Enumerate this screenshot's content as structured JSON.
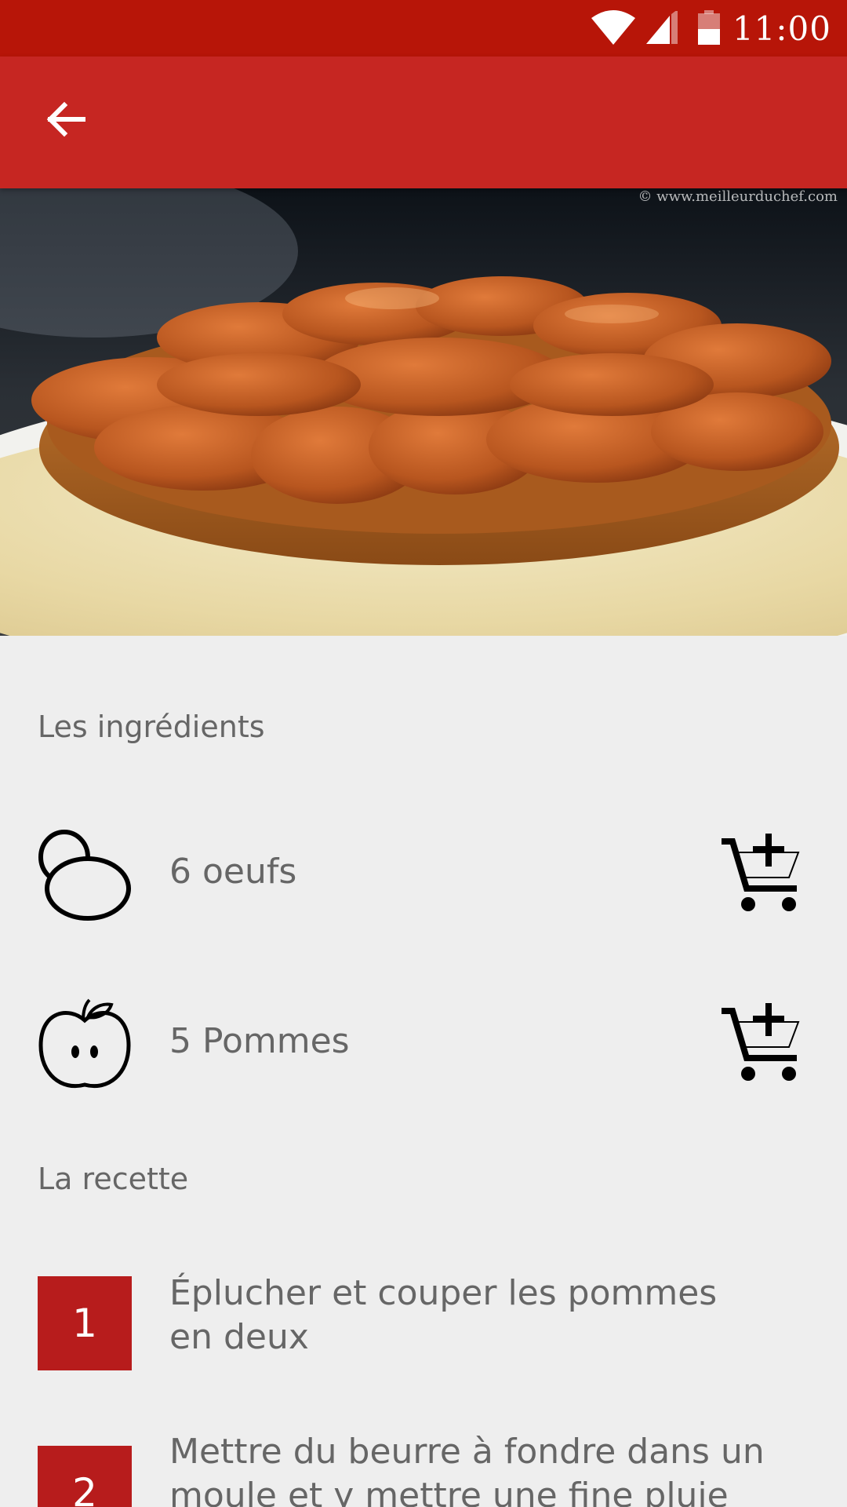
{
  "status_bar": {
    "time": "11:00",
    "icons": [
      "wifi-icon",
      "cell-signal-icon",
      "battery-icon"
    ]
  },
  "app_bar": {
    "back_icon": "arrow-back-icon"
  },
  "hero": {
    "watermark": "© www.meilleurduchef.com"
  },
  "ingredients": {
    "title": "Les ingrédients",
    "items": [
      {
        "icon": "egg-icon",
        "label": "6 oeufs",
        "action_icon": "add-to-cart-icon"
      },
      {
        "icon": "apple-icon",
        "label": "5 Pommes",
        "action_icon": "add-to-cart-icon"
      }
    ]
  },
  "recipe": {
    "title": "La recette",
    "steps": [
      {
        "number": "1",
        "text": "Éplucher et couper les pommes en deux"
      },
      {
        "number": "2",
        "text": "Mettre du beurre à fondre dans un moule et y mettre une fine pluie de"
      }
    ]
  },
  "colors": {
    "status_bar": "#b71508",
    "app_bar": "#c62622",
    "step_badge": "#b71c1c",
    "background": "#eeeeee",
    "text_secondary": "#666666"
  }
}
